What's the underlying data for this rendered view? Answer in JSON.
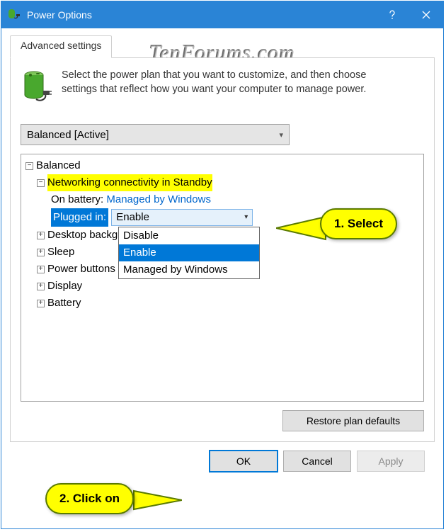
{
  "window": {
    "title": "Power Options"
  },
  "watermark": "TenForums.com",
  "tab_label": "Advanced settings",
  "intro_text": "Select the power plan that you want to customize, and then choose settings that reflect how you want your computer to manage power.",
  "plan_selector": "Balanced [Active]",
  "tree": {
    "root": "Balanced",
    "highlighted": "Networking connectivity in Standby",
    "on_battery_label": "On battery:",
    "on_battery_value": "Managed by Windows",
    "plugged_in_label": "Plugged in:",
    "plugged_in_value": "Enable",
    "options": {
      "disable": "Disable",
      "enable": "Enable",
      "managed": "Managed by Windows"
    },
    "nodes": {
      "desktop_bg": "Desktop background settings",
      "sleep": "Sleep",
      "power_buttons": "Power buttons and lid",
      "display": "Display",
      "battery": "Battery"
    }
  },
  "buttons": {
    "restore": "Restore plan defaults",
    "ok": "OK",
    "cancel": "Cancel",
    "apply": "Apply"
  },
  "callouts": {
    "select": "1. Select",
    "click": "2. Click on"
  }
}
